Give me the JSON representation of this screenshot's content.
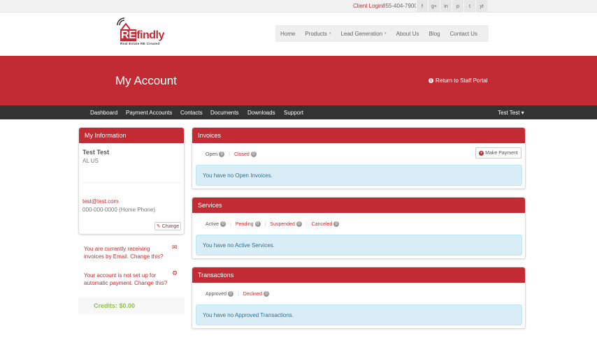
{
  "topbar": {
    "client_login": "Client Login",
    "phone": "855-404-7900",
    "social": [
      "f",
      "g+",
      "in",
      "p",
      "t",
      "yt"
    ]
  },
  "logo": {
    "re": "RE",
    "findly": "findly",
    "tagline": "Real Estate RE Created"
  },
  "mainnav": {
    "items": [
      {
        "label": "Home"
      },
      {
        "label": "Products",
        "caret": "▾"
      },
      {
        "label": "Lead Generation",
        "caret": "▾"
      },
      {
        "label": "About Us"
      },
      {
        "label": "Blog"
      },
      {
        "label": "Contact Us"
      }
    ]
  },
  "banner": {
    "title": "My Account",
    "return_label": "Return to Staff Portal"
  },
  "darknav": {
    "items": [
      "Dashboard",
      "Payment Accounts",
      "Contacts",
      "Documents",
      "Downloads",
      "Support"
    ],
    "user": "Test Test"
  },
  "my_info": {
    "heading": "My Information",
    "name": "Test Test",
    "location": "AL US",
    "email": "test@test.com",
    "phone": "000-000-0000 (Home Phone)",
    "change_label": "Change"
  },
  "notices": {
    "email": "You are currently receiving invoices by Email. Change this?",
    "payment": "Your account is not set up for automatic payment. Change this?"
  },
  "credits": "Credits: $0.00",
  "invoices": {
    "heading": "Invoices",
    "filters": [
      {
        "label": "Open",
        "count": "0"
      },
      {
        "label": "Closed",
        "count": "0"
      }
    ],
    "button": "Make Payment",
    "message": "You have no Open Invoices."
  },
  "services": {
    "heading": "Services",
    "filters": [
      {
        "label": "Active",
        "count": "0"
      },
      {
        "label": "Pending",
        "count": "0"
      },
      {
        "label": "Suspended",
        "count": "0"
      },
      {
        "label": "Canceled",
        "count": "0"
      }
    ],
    "message": "You have no Active Services."
  },
  "transactions": {
    "heading": "Transactions",
    "filters": [
      {
        "label": "Approved",
        "count": "0"
      },
      {
        "label": "Declined",
        "count": "0"
      }
    ],
    "message": "You have no Approved Transactions."
  }
}
